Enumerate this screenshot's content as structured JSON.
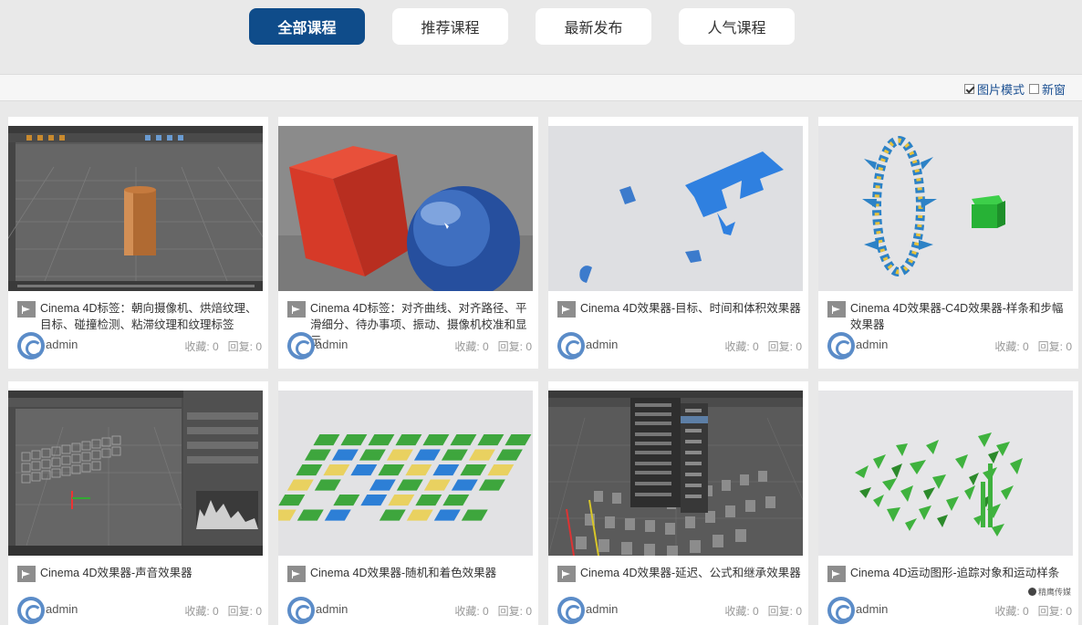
{
  "tabs": [
    {
      "label": "全部课程",
      "active": true
    },
    {
      "label": "推荐课程",
      "active": false
    },
    {
      "label": "最新发布",
      "active": false
    },
    {
      "label": "人气课程",
      "active": false
    }
  ],
  "options": {
    "image_mode_label": "图片模式",
    "image_mode_checked": true,
    "new_window_label": "新窗",
    "new_window_checked": false
  },
  "colors": {
    "accent": "#0f4c8a",
    "link": "#1a4f91",
    "page_bg": "#e9e9e9"
  },
  "courses": [
    {
      "title": "Cinema 4D标签：朝向摄像机、烘焙纹理、目标、碰撞检测、粘滞纹理和纹理标签",
      "author": "admin",
      "favorites": "收藏: 0",
      "replies": "回复: 0",
      "thumb": "viewport-cylinder"
    },
    {
      "title": "Cinema 4D标签：对齐曲线、对齐路径、平滑细分、待办事项、振动、摄像机校准和显示",
      "author": "admin",
      "favorites": "收藏: 0",
      "replies": "回复: 0",
      "thumb": "red-cube-blue-sphere"
    },
    {
      "title": "Cinema 4D效果器-目标、时间和体积效果器",
      "author": "admin",
      "favorites": "收藏: 0",
      "replies": "回复: 0",
      "thumb": "blue-scattered-letters"
    },
    {
      "title": "Cinema 4D效果器-C4D效果器-样条和步幅效果器",
      "author": "admin",
      "favorites": "收藏: 0",
      "replies": "回复: 0",
      "thumb": "cone-ring-green-cube"
    },
    {
      "title": "Cinema 4D效果器-声音效果器",
      "author": "admin",
      "favorites": "收藏: 0",
      "replies": "回复: 0",
      "thumb": "viewport-sound"
    },
    {
      "title": "Cinema 4D效果器-随机和着色效果器",
      "author": "admin",
      "favorites": "收藏: 0",
      "replies": "回复: 0",
      "thumb": "colored-tiles"
    },
    {
      "title": "Cinema 4D效果器-延迟、公式和继承效果器",
      "author": "admin",
      "favorites": "收藏: 0",
      "replies": "回复: 0",
      "thumb": "viewport-menu-cubes"
    },
    {
      "title": "Cinema 4D运动图形-追踪对象和运动样条",
      "author": "admin",
      "favorites": "收藏: 0",
      "replies": "回复: 0",
      "thumb": "green-shards"
    }
  ],
  "watermark": "精鹰传媒"
}
